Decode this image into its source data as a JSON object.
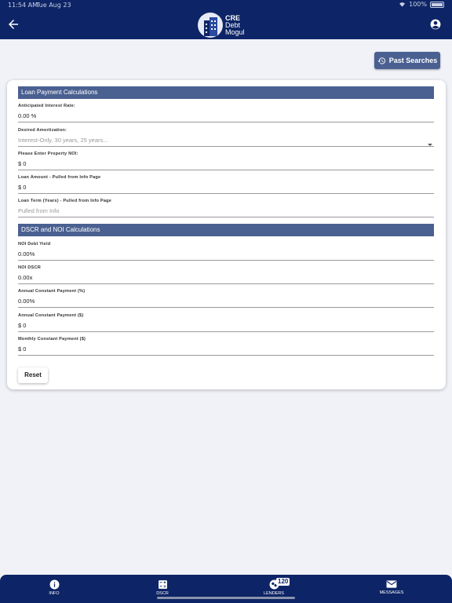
{
  "status_bar": {
    "time": "11:54 AM",
    "date": "Tue Aug 23",
    "battery": "100%"
  },
  "header": {
    "logo_lines": [
      "CRE",
      "Debt",
      "Mogul"
    ],
    "back_icon": "arrow-left-icon",
    "account_icon": "account-circle-icon"
  },
  "past_searches": {
    "label": "Past Searches",
    "icon": "history-icon"
  },
  "loan_section": {
    "title": "Loan Payment Calculations",
    "fields": [
      {
        "label": "Anticipated Interest Rate:",
        "value": "0.00 %"
      },
      {
        "label": "Desired Amortization:",
        "value": "Interest-Only, 30 years, 25 years..."
      },
      {
        "label": "Please Enter Property NOI:",
        "value": "$ 0"
      },
      {
        "label": "Loan Amount - Pulled from Info Page",
        "value": "$ 0"
      },
      {
        "label": "Loan Term (Years) - Pulled from Info Page",
        "value": "Pulled from Info"
      }
    ]
  },
  "dscr_section": {
    "title": "DSCR and NOI Calculations",
    "fields": [
      {
        "label": "NOI Debt Yield",
        "value": "0.00%"
      },
      {
        "label": "NOI DSCR",
        "value": "0.00x"
      },
      {
        "label": "Annual Constant Payment (%)",
        "value": "0.00%"
      },
      {
        "label": "Annual Constant Payment ($)",
        "value": "$ 0"
      },
      {
        "label": "Monthly Constant Payment ($)",
        "value": "$ 0"
      }
    ]
  },
  "reset_label": "Reset",
  "bottom_nav": {
    "items": [
      {
        "label": "INFO",
        "icon": "info-icon"
      },
      {
        "label": "DSCR",
        "icon": "calculator-icon"
      },
      {
        "label": "LENDERS",
        "icon": "lenders-icon",
        "badge": "120"
      },
      {
        "label": "MESSAGES",
        "icon": "mail-icon"
      }
    ]
  },
  "colors": {
    "navy": "#0d2466",
    "section": "#4a6091",
    "background": "#f0f2f8"
  }
}
